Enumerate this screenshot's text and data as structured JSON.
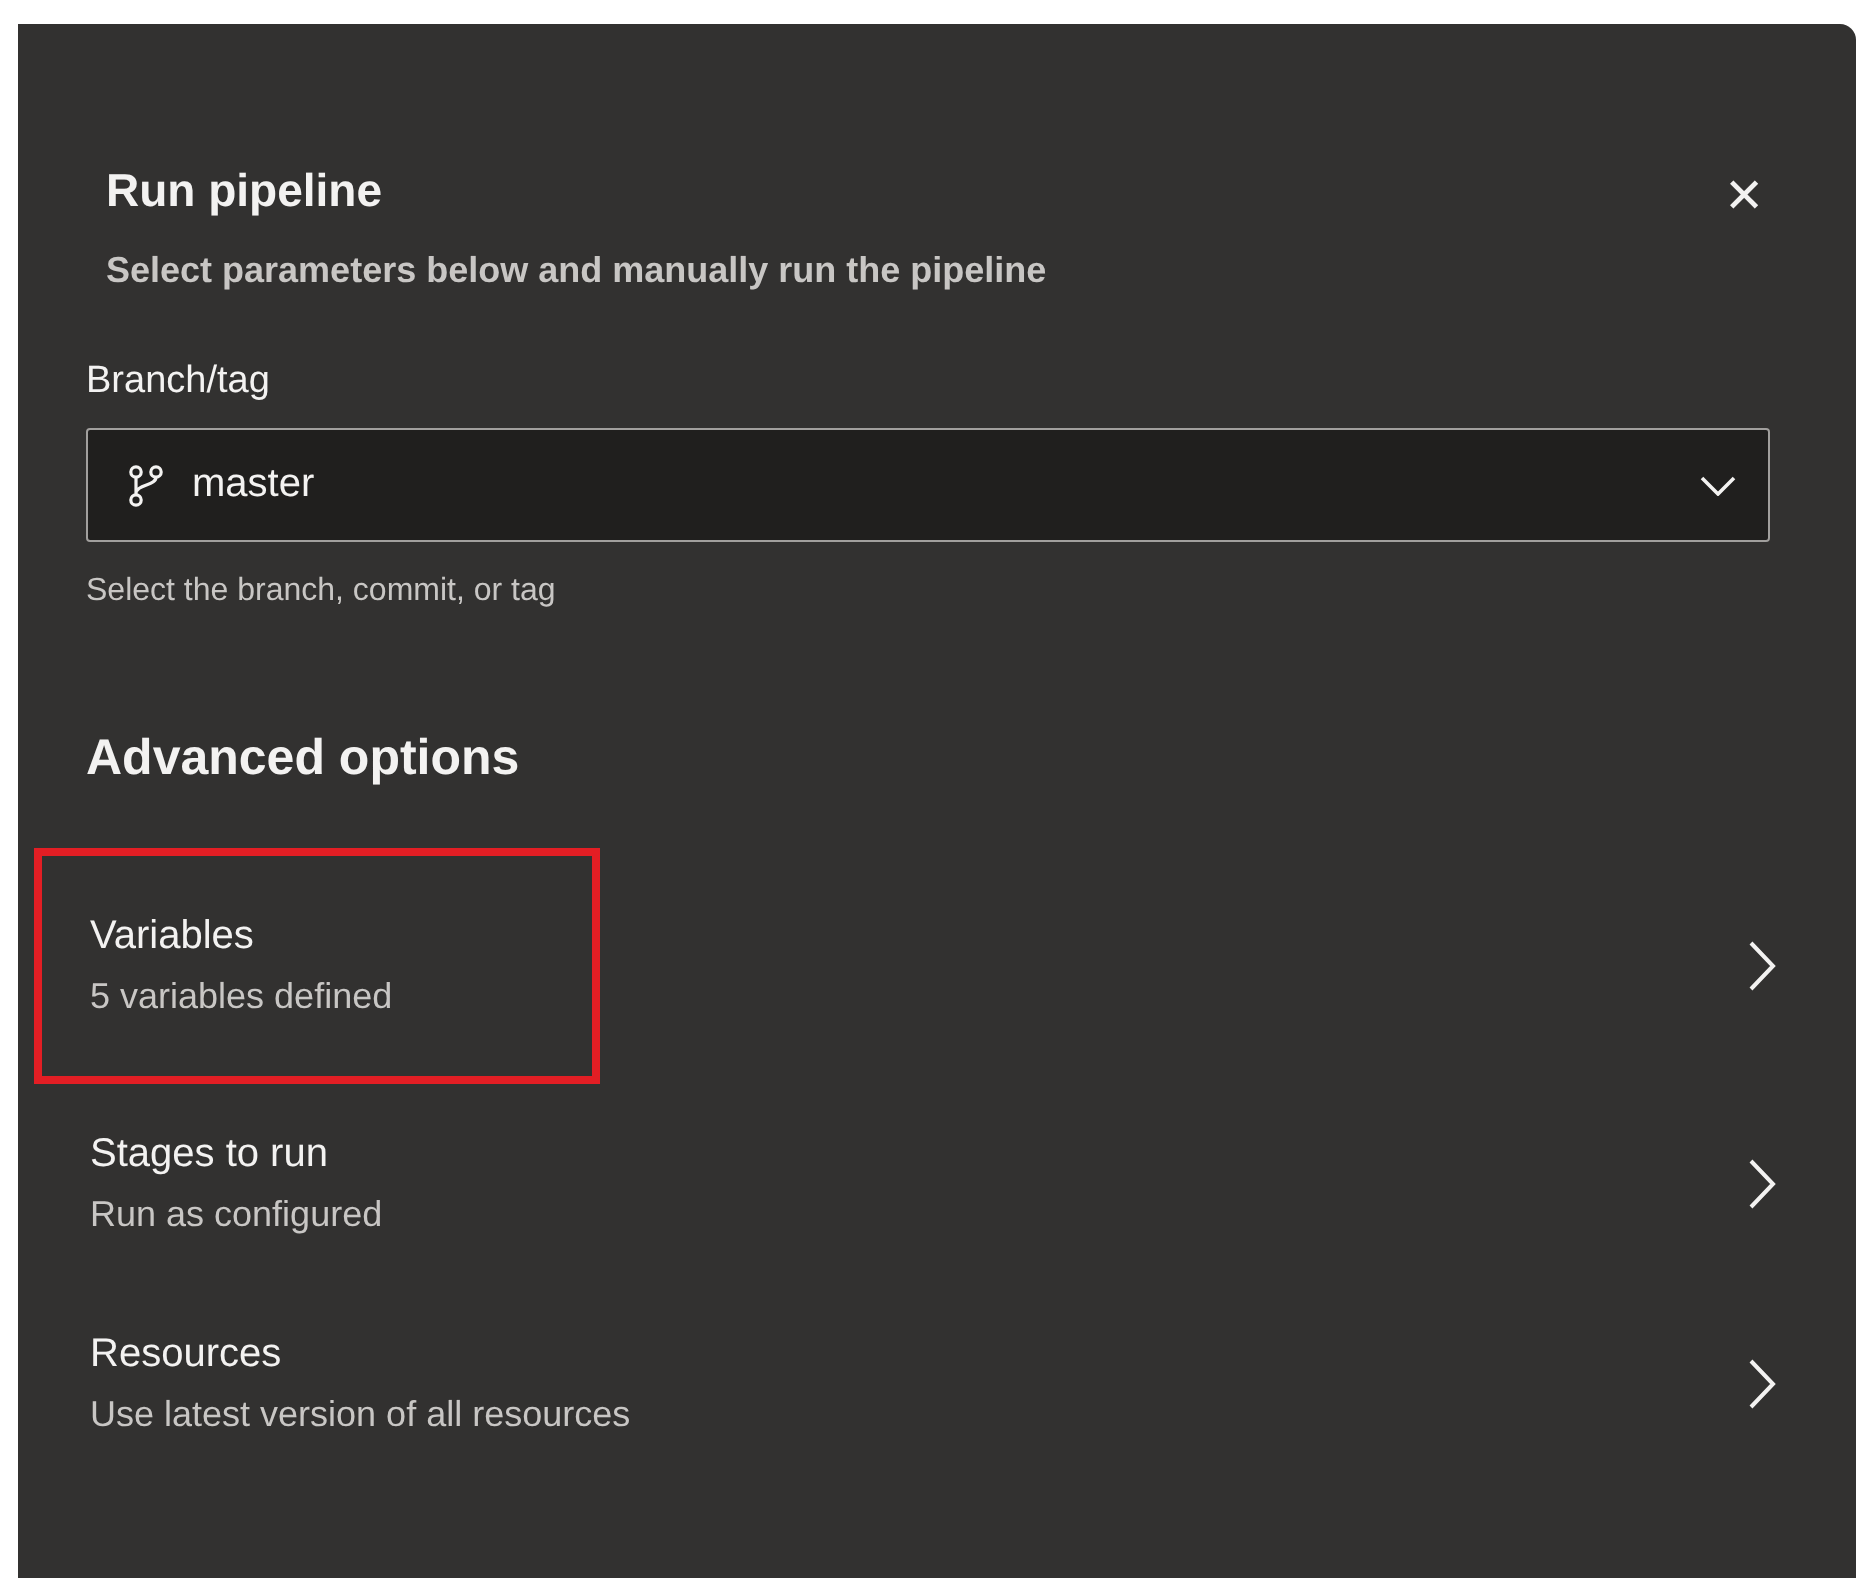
{
  "dialog": {
    "title": "Run pipeline",
    "subtitle": "Select parameters below and manually run the pipeline",
    "close_glyph": "✕"
  },
  "branch": {
    "label": "Branch/tag",
    "value": "master",
    "helper": "Select the branch, commit, or tag"
  },
  "advanced": {
    "heading": "Advanced options",
    "items": [
      {
        "title": "Variables",
        "description": "5 variables defined",
        "highlighted": true
      },
      {
        "title": "Stages to run",
        "description": "Run as configured",
        "highlighted": false
      },
      {
        "title": "Resources",
        "description": "Use latest version of all resources",
        "highlighted": false
      }
    ]
  }
}
